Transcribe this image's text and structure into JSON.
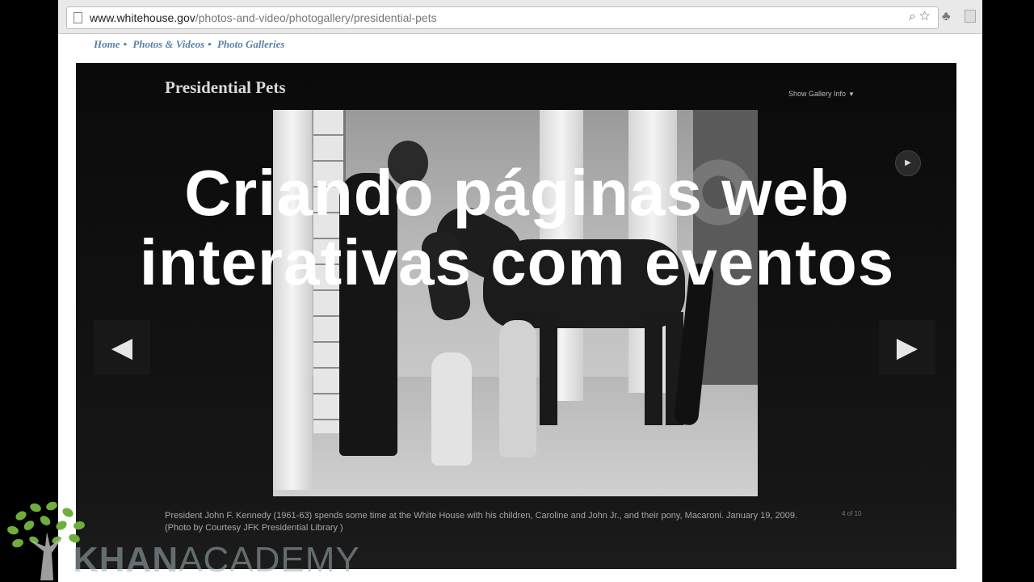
{
  "browser": {
    "url_host": "www.whitehouse.gov",
    "url_path": "/photos-and-video/photogallery/presidential-pets"
  },
  "breadcrumb": [
    "Home",
    "Photos & Videos",
    "Photo Galleries"
  ],
  "breadcrumb_separator": "•",
  "gallery": {
    "title": "Presidential Pets",
    "info_toggle": "Show Gallery Info",
    "caption": "President John F. Kennedy (1961-63) spends some time at the White House with his children, Caroline and John Jr., and their pony, Macaroni. January 19, 2009. (Photo by Courtesy JFK Presidential Library )",
    "counter": "4 of 10"
  },
  "overlay": {
    "line1": "Criando páginas web",
    "line2": "interativas com eventos"
  },
  "watermark": {
    "brand_bold": "KHAN",
    "brand_light": "ACADEMY"
  },
  "icons": {
    "prev": "chevron-left-icon",
    "next": "chevron-right-icon",
    "play": "play-icon"
  },
  "colors": {
    "breadcrumb": "#5a7fa6",
    "gallery_bg": "#0a0a0a",
    "ka_tree": "#6fae3c"
  }
}
